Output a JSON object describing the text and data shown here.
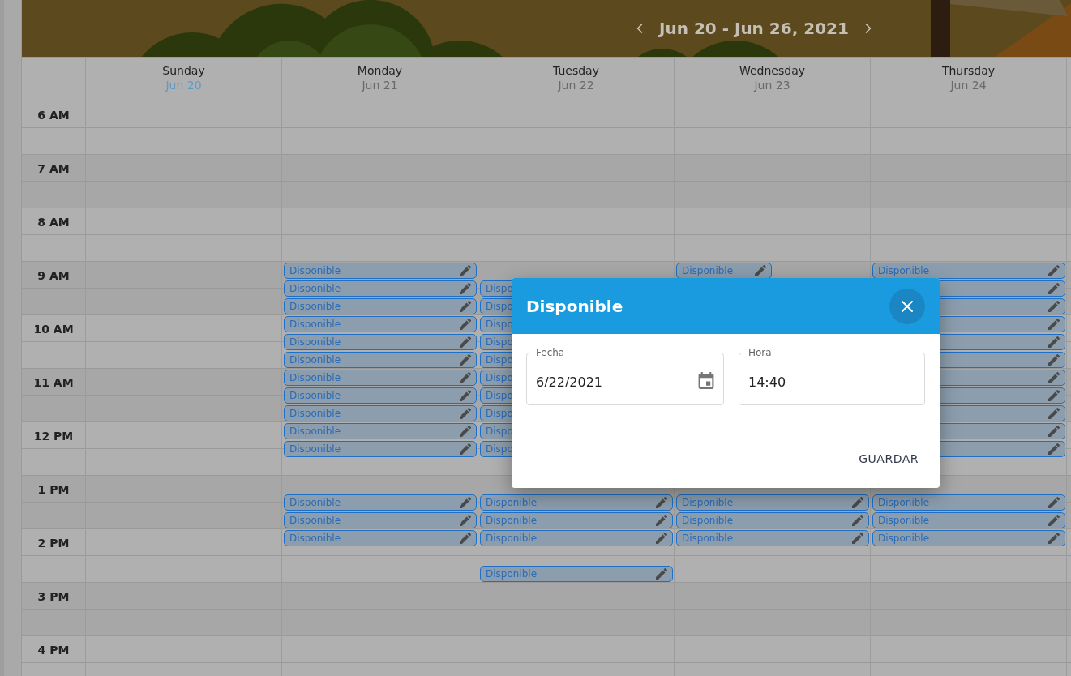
{
  "toolbar": {
    "range": "Jun 20 - Jun 26, 2021"
  },
  "times": [
    "6 AM",
    "7 AM",
    "8 AM",
    "9 AM",
    "10 AM",
    "11 AM",
    "12 PM",
    "1 PM",
    "2 PM",
    "3 PM",
    "4 PM"
  ],
  "days": [
    {
      "name": "Sunday",
      "date": "Jun 20",
      "today": true
    },
    {
      "name": "Monday",
      "date": "Jun 21",
      "today": false,
      "slots": [
        {
          "kind": "full",
          "label": "Disponible",
          "edit_icon": true
        },
        {
          "kind": "full",
          "label": "Disponible",
          "edit_icon": true
        },
        {
          "kind": "full",
          "label": "Disponible",
          "edit_icon": true
        },
        {
          "kind": "full",
          "label": "Disponible",
          "edit_icon": true
        },
        {
          "kind": "full",
          "label": "Disponible",
          "edit_icon": true
        },
        {
          "kind": "full",
          "label": "Disponible",
          "edit_icon": true
        },
        {
          "kind": "full",
          "label": "Disponible",
          "edit_icon": true
        },
        {
          "kind": "full",
          "label": "Disponible",
          "edit_icon": true
        },
        {
          "kind": "full",
          "label": "Disponible",
          "edit_icon": true
        },
        {
          "kind": "full",
          "label": "Disponible",
          "edit_icon": true
        },
        {
          "kind": "full",
          "label": "Disponible",
          "edit_icon": true
        },
        {
          "kind": "empty"
        },
        {
          "kind": "empty"
        },
        {
          "kind": "full",
          "label": "Disponible",
          "edit_icon": true
        },
        {
          "kind": "full",
          "label": "Disponible",
          "edit_icon": true
        },
        {
          "kind": "full",
          "label": "Disponible",
          "edit_icon": true
        }
      ]
    },
    {
      "name": "Tuesday",
      "date": "Jun 22",
      "today": false,
      "slots": [
        {
          "kind": "empty"
        },
        {
          "kind": "full",
          "label": "Dispo"
        },
        {
          "kind": "full",
          "label": "Dispo"
        },
        {
          "kind": "full",
          "label": "Dispo"
        },
        {
          "kind": "full",
          "label": "Dispo"
        },
        {
          "kind": "full",
          "label": "Dispo"
        },
        {
          "kind": "full",
          "label": "Dispo"
        },
        {
          "kind": "full",
          "label": "Dispo"
        },
        {
          "kind": "full",
          "label": "Dispo"
        },
        {
          "kind": "full",
          "label": "Dispo"
        },
        {
          "kind": "full",
          "label": "Dispo"
        },
        {
          "kind": "empty"
        },
        {
          "kind": "empty"
        },
        {
          "kind": "full",
          "label": "Disponible",
          "edit_icon": true
        },
        {
          "kind": "full",
          "label": "Disponible",
          "edit_icon": true
        },
        {
          "kind": "full",
          "label": "Disponible",
          "edit_icon": true
        },
        {
          "kind": "empty"
        },
        {
          "kind": "full",
          "label": "Disponible",
          "edit_icon": true
        }
      ]
    },
    {
      "name": "Wednesday",
      "date": "Jun 23",
      "today": false,
      "slots": [
        {
          "kind": "half",
          "label": "Disponible",
          "edit_icon": true
        },
        {
          "kind": "empty"
        },
        {
          "kind": "empty"
        },
        {
          "kind": "empty"
        },
        {
          "kind": "empty"
        },
        {
          "kind": "empty"
        },
        {
          "kind": "empty"
        },
        {
          "kind": "empty"
        },
        {
          "kind": "empty"
        },
        {
          "kind": "empty"
        },
        {
          "kind": "empty"
        },
        {
          "kind": "empty"
        },
        {
          "kind": "empty"
        },
        {
          "kind": "full",
          "label": "Disponible",
          "edit_icon": true
        },
        {
          "kind": "full",
          "label": "Disponible",
          "edit_icon": true
        },
        {
          "kind": "full",
          "label": "Disponible",
          "edit_icon": true
        }
      ]
    },
    {
      "name": "Thursday",
      "date": "Jun 24",
      "today": false,
      "slots": [
        {
          "kind": "full",
          "label": "Disponible",
          "edit_icon": true
        },
        {
          "kind": "full",
          "edit_icon": true
        },
        {
          "kind": "full",
          "edit_icon": true
        },
        {
          "kind": "full",
          "edit_icon": true
        },
        {
          "kind": "full",
          "edit_icon": true
        },
        {
          "kind": "full",
          "edit_icon": true
        },
        {
          "kind": "full",
          "edit_icon": true
        },
        {
          "kind": "full",
          "edit_icon": true
        },
        {
          "kind": "full",
          "edit_icon": true
        },
        {
          "kind": "full",
          "edit_icon": true
        },
        {
          "kind": "full",
          "edit_icon": true
        },
        {
          "kind": "empty"
        },
        {
          "kind": "empty"
        },
        {
          "kind": "full",
          "label": "Disponible",
          "edit_icon": true
        },
        {
          "kind": "full",
          "label": "Disponible",
          "edit_icon": true
        },
        {
          "kind": "full",
          "label": "Disponible",
          "edit_icon": true
        }
      ]
    }
  ],
  "dialog": {
    "title": "Disponible",
    "fields": [
      {
        "kind": "date",
        "label": "Fecha",
        "value": "6/22/2021"
      },
      {
        "kind": "time",
        "label": "Hora",
        "value": "14:40"
      }
    ],
    "button": "GUARDAR"
  }
}
